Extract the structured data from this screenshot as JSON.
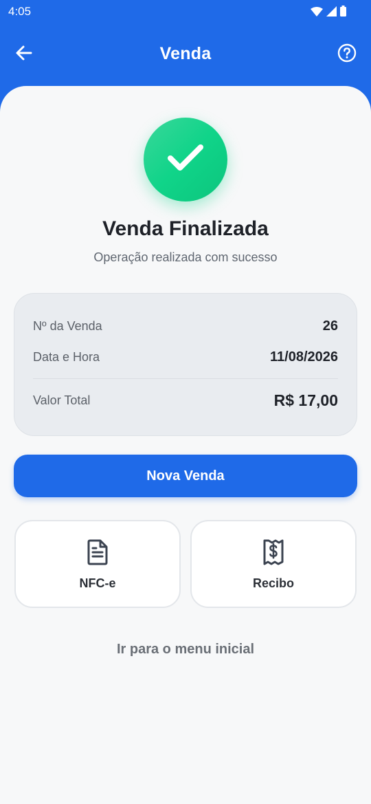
{
  "status_bar": {
    "time": "4:05"
  },
  "app_bar": {
    "title": "Venda"
  },
  "result": {
    "headline": "Venda Finalizada",
    "subline": "Operação realizada com sucesso"
  },
  "summary": {
    "sale_number_label": "Nº da Venda",
    "sale_number": "26",
    "datetime_label": "Data e Hora",
    "datetime": "11/08/2026",
    "total_label": "Valor Total",
    "total": "R$ 17,00"
  },
  "actions": {
    "primary_label": "Nova Venda",
    "nfce_label": "NFC-e",
    "receipt_label": "Recibo",
    "home_link": "Ir para o menu inicial"
  },
  "colors": {
    "brand_blue": "#1f6ae8",
    "success_green": "#10d489"
  }
}
